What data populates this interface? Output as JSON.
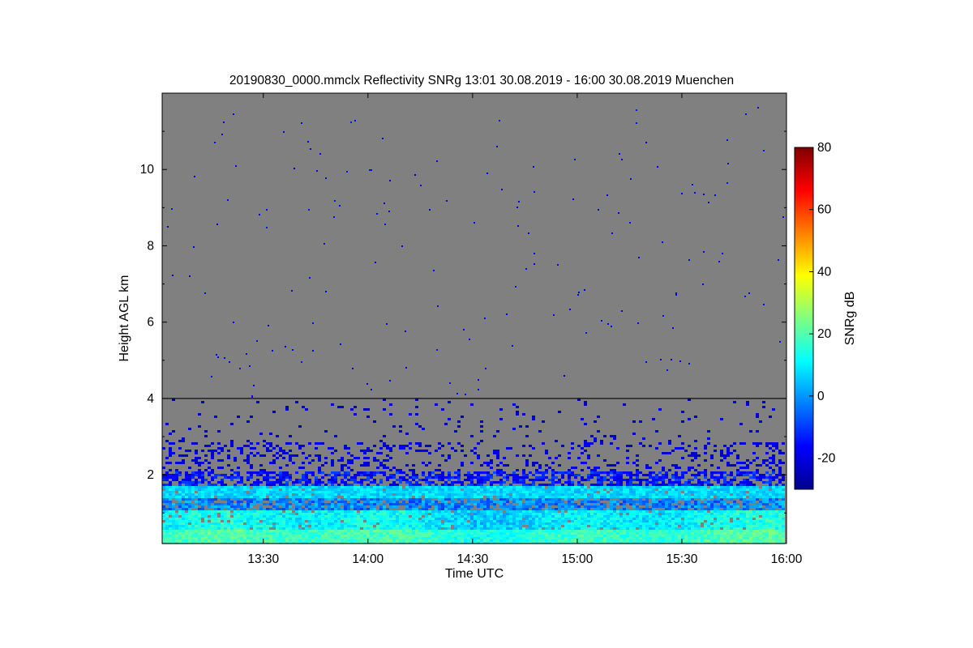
{
  "chart_data": {
    "type": "heatmap",
    "title": "20190830_0000.mmclx Reflectivity SNRg   13:01 30.08.2019 - 16:00 30.08.2019 Muenchen",
    "xlabel": "Time UTC",
    "ylabel": "Height AGL km",
    "colorbar_label": "SNRg dB",
    "x_range": [
      "13:01",
      "16:00"
    ],
    "y_range": [
      0.2,
      12.0
    ],
    "x_ticks": [
      {
        "label": "13:30",
        "min": 29
      },
      {
        "label": "14:00",
        "min": 59
      },
      {
        "label": "14:30",
        "min": 89
      },
      {
        "label": "15:00",
        "min": 119
      },
      {
        "label": "15:30",
        "min": 149
      },
      {
        "label": "16:00",
        "min": 179
      }
    ],
    "y_ticks": [
      2,
      4,
      6,
      8,
      10
    ],
    "colorbar_ticks": [
      -20,
      0,
      20,
      40,
      60,
      80
    ],
    "color_range": [
      -30,
      80
    ],
    "reference_line_km": 4.0,
    "background_color": "#808080",
    "colormap": [
      "#00008f",
      "#0000ff",
      "#0080ff",
      "#00ffff",
      "#80ff80",
      "#ffff00",
      "#ff8000",
      "#ff0000",
      "#800000"
    ],
    "layers": [
      {
        "name": "Strong boundary-layer echo",
        "min_km": 0.2,
        "max_km": 1.0,
        "snr_db": [
          5,
          20
        ]
      },
      {
        "name": "Clear-air band",
        "center_km": 1.6,
        "snr_db": [
          5,
          12
        ]
      },
      {
        "name": "Sparse echoes",
        "min_km": 1.8,
        "max_km": 3.8,
        "snr_db": [
          -25,
          -10
        ]
      },
      {
        "name": "Isolated noise points",
        "min_km": 4.0,
        "max_km": 12.0,
        "snr_db": [
          -25,
          -15
        ]
      }
    ]
  }
}
